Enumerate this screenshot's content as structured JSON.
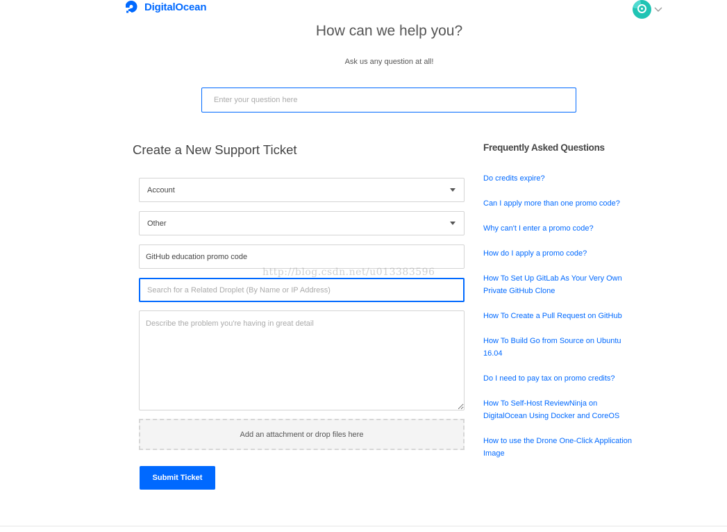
{
  "header": {
    "logo_text": "DigitalOcean",
    "brand_color": "#0069ff"
  },
  "hero": {
    "title": "How can we help you?",
    "subtitle": "Ask us any question at all!",
    "search_placeholder": "Enter your question here"
  },
  "ticket": {
    "title": "Create a New Support Ticket",
    "category_value": "Account",
    "subcategory_value": "Other",
    "subject_value": "GitHub education promo code",
    "droplet_placeholder": "Search for a Related Droplet (By Name or IP Address)",
    "description_placeholder": "Describe the problem you're having in great detail",
    "attachment_label": "Add an attachment or drop files here",
    "submit_label": "Submit Ticket"
  },
  "faq": {
    "title": "Frequently Asked Questions",
    "items": [
      "Do credits expire?",
      "Can I apply more than one promo code?",
      "Why can't I enter a promo code?",
      "How do I apply a promo code?",
      "How To Set Up GitLab As Your Very Own Private GitHub Clone",
      "How To Create a Pull Request on GitHub",
      "How To Build Go from Source on Ubuntu 16.04",
      "Do I need to pay tax on promo credits?",
      "How To Self-Host ReviewNinja on DigitalOcean Using Docker and CoreOS",
      "How to use the Drone One-Click Application Image"
    ]
  },
  "watermark": "http://blog.csdn.net/u013383596"
}
